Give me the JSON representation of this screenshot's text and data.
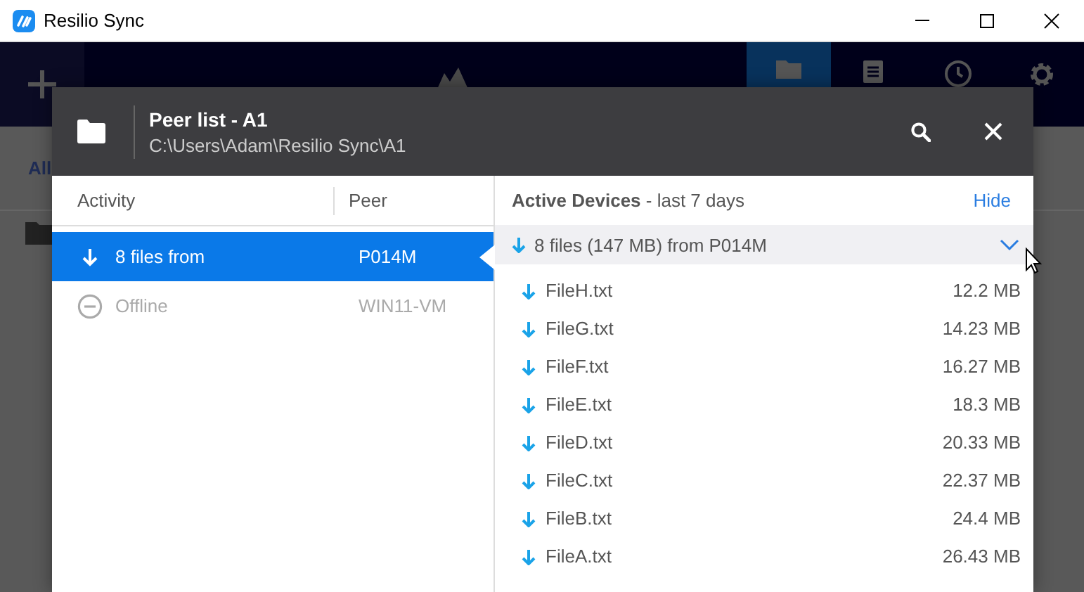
{
  "window": {
    "title": "Resilio Sync"
  },
  "app_header": {
    "nav": [
      {
        "kind": "folders",
        "selected": true
      },
      {
        "kind": "list",
        "selected": false
      },
      {
        "kind": "history",
        "selected": false
      },
      {
        "kind": "settings",
        "selected": false
      }
    ]
  },
  "toolbar": {
    "filter_label": "All"
  },
  "dialog": {
    "title": "Peer list - A1",
    "path": "C:\\Users\\Adam\\Resilio Sync\\A1",
    "columns": [
      "Activity",
      "Peer"
    ],
    "peers": [
      {
        "activity": "8 files from",
        "peer": "P014M",
        "kind": "downloading",
        "selected": true
      },
      {
        "activity": "Offline",
        "peer": "WIN11-VM",
        "kind": "offline",
        "selected": false
      }
    ],
    "active_devices": {
      "title": "**Active Devices** - last 7 days",
      "hide": "Hide",
      "group": {
        "label": "8 files (147 MB) from P014M",
        "expanded": true
      },
      "files": [
        {
          "name": "FileH.txt",
          "size": "12.2 MB"
        },
        {
          "name": "FileG.txt",
          "size": "14.23 MB"
        },
        {
          "name": "FileF.txt",
          "size": "16.27 MB"
        },
        {
          "name": "FileE.txt",
          "size": "18.3 MB"
        },
        {
          "name": "FileD.txt",
          "size": "20.33 MB"
        },
        {
          "name": "FileC.txt",
          "size": "22.37 MB"
        },
        {
          "name": "FileB.txt",
          "size": "24.4 MB"
        },
        {
          "name": "FileA.txt",
          "size": "26.43 MB"
        }
      ]
    }
  }
}
